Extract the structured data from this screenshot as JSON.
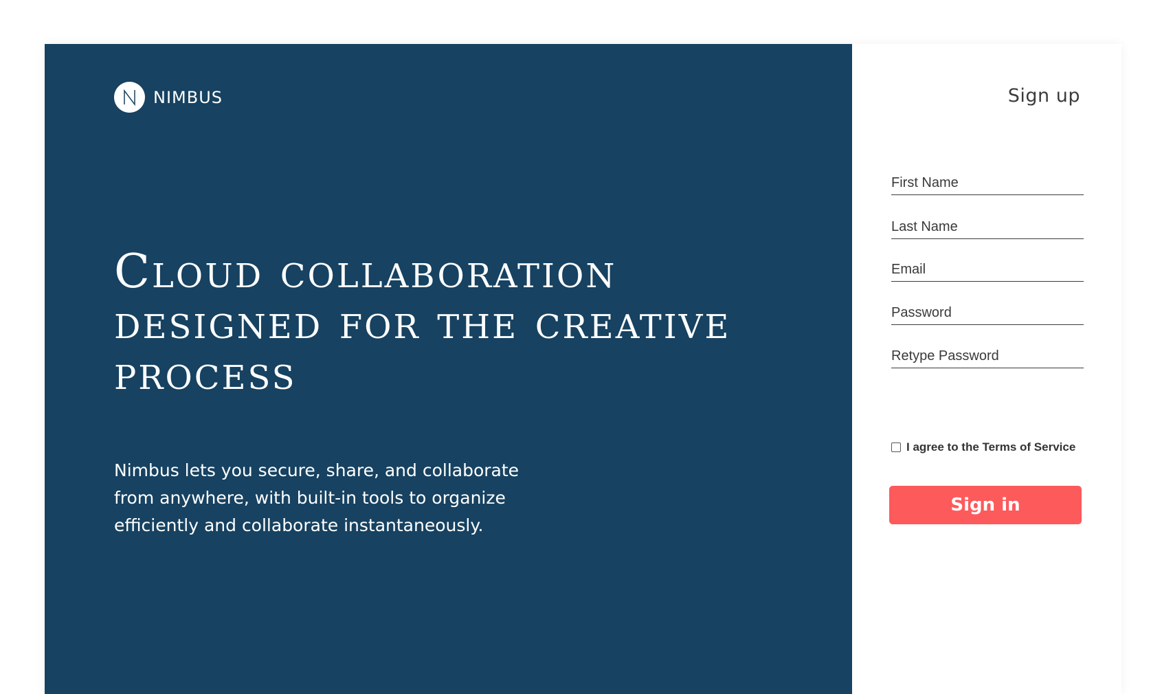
{
  "brand": {
    "name": "NIMBUS",
    "logo_icon": "nimbus-logo-icon",
    "logo_letter": "N"
  },
  "hero": {
    "headline": "Cloud collaboration designed for the creative process",
    "description": "Nimbus lets you secure, share, and collaborate from anywhere, with built-in tools to organize efficiently and collaborate instantaneously."
  },
  "form": {
    "title": "Sign up",
    "fields": {
      "first_name": {
        "placeholder": "First Name",
        "value": ""
      },
      "last_name": {
        "placeholder": "Last Name",
        "value": ""
      },
      "email": {
        "placeholder": "Email",
        "value": ""
      },
      "password": {
        "placeholder": "Password",
        "value": ""
      },
      "retype_password": {
        "placeholder": "Retype Password",
        "value": ""
      }
    },
    "terms_label": "I agree to the Terms of Service",
    "terms_checked": false,
    "submit_label": "Sign in"
  },
  "colors": {
    "hero_background": "#174261",
    "accent_button": "#fd5a5c",
    "text_dark": "#3c3c3c",
    "text_light": "#ffffff"
  }
}
